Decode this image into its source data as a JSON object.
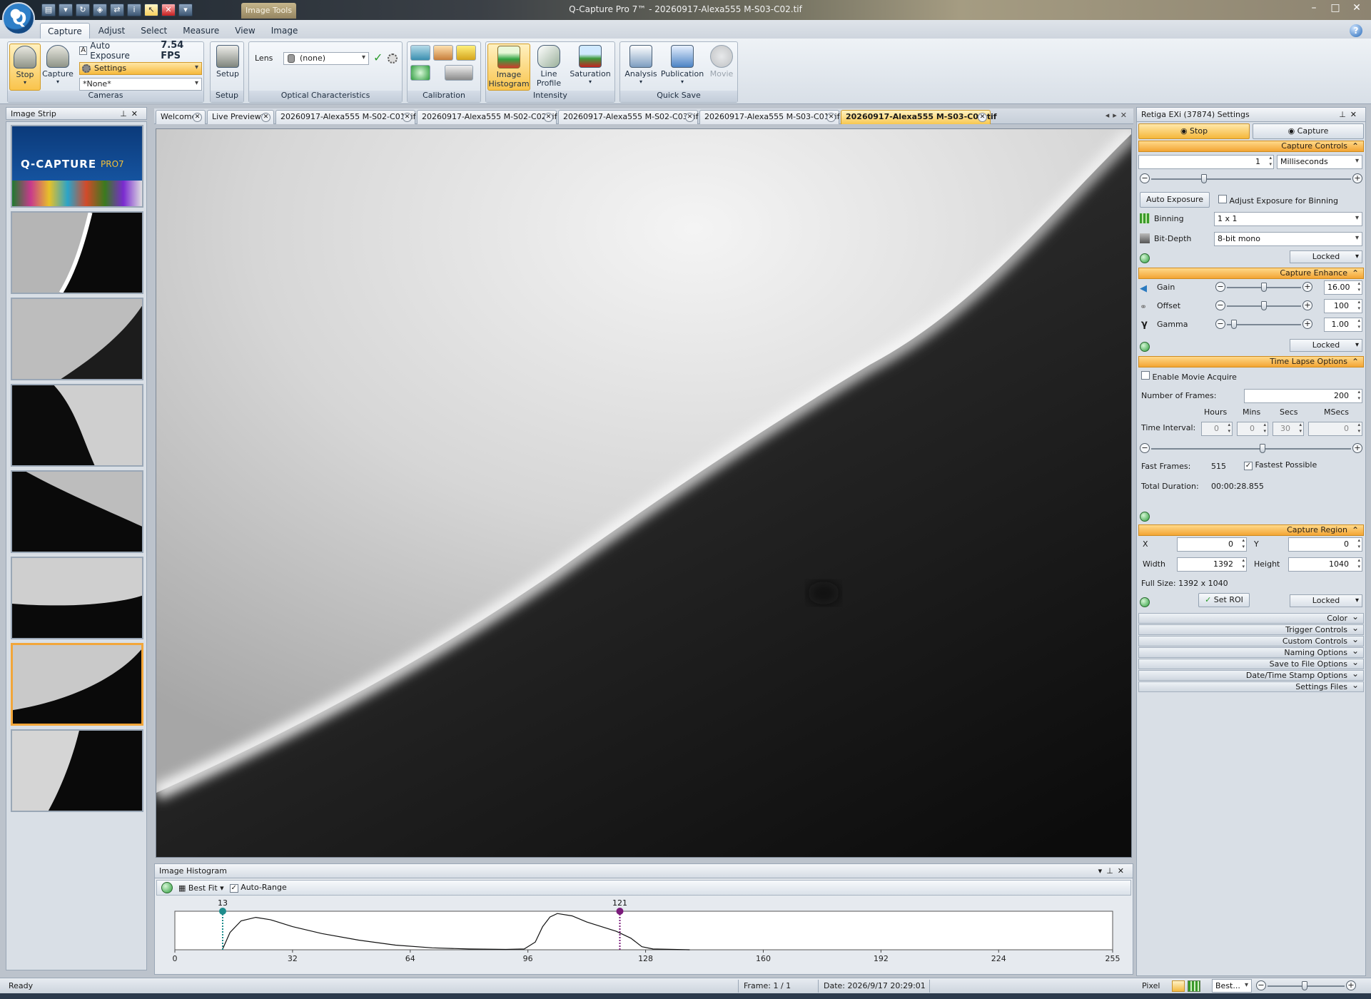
{
  "window": {
    "title": "Q-Capture Pro 7™ - 20260917-Alexa555 M-S03-C02.tif",
    "context_tab": "Image Tools",
    "logo_letter": "Q",
    "help": "?"
  },
  "ribbon_tabs": [
    "Capture",
    "Adjust",
    "Select",
    "Measure",
    "View",
    "Image"
  ],
  "ribbon": {
    "stop_label": "Stop",
    "capture_label": "Capture",
    "auto_exposure_label": "Auto Exposure",
    "fps": "7.54 FPS",
    "settings_label": "Settings",
    "preset_label": "*None*",
    "cameras_group": "Cameras",
    "setup_label": "Setup",
    "setup_group": "Setup",
    "lens_label": "Lens",
    "lens_value": "(none)",
    "optical_group": "Optical Characteristics",
    "calibration_group": "Calibration",
    "image_histogram_label_1": "Image",
    "image_histogram_label_2": "Histogram",
    "line_profile_label_1": "Line",
    "line_profile_label_2": "Profile",
    "saturation_label": "Saturation",
    "intensity_group": "Intensity",
    "analysis_label": "Analysis",
    "publication_label": "Publication",
    "movie_label": "Movie",
    "quicksave_group": "Quick Save"
  },
  "image_strip": {
    "title": "Image Strip",
    "splash_title": "Q-CAPTURE",
    "splash_suffix": "PRO7",
    "selected_index": 6
  },
  "doc_tabs": [
    {
      "label": "Welcome"
    },
    {
      "label": "Live Preview*"
    },
    {
      "label": "20260917-Alexa555 M-S02-C01.tif"
    },
    {
      "label": "20260917-Alexa555 M-S02-C02.tif"
    },
    {
      "label": "20260917-Alexa555 M-S02-C03.tif"
    },
    {
      "label": "20260917-Alexa555 M-S03-C01.tif"
    },
    {
      "label": "20260917-Alexa555 M-S03-C02.tif",
      "active": true
    }
  ],
  "histogram": {
    "title": "Image Histogram",
    "best_fit": "Best Fit",
    "auto_range": "Auto-Range",
    "auto_range_checked": true,
    "low_marker": 13,
    "high_marker": 121,
    "x_min": 0,
    "x_max": 255,
    "ticks": [
      0,
      32,
      64,
      96,
      128,
      160,
      192,
      224,
      255
    ],
    "curve": [
      [
        13,
        0.02
      ],
      [
        15,
        0.45
      ],
      [
        18,
        0.75
      ],
      [
        22,
        0.84
      ],
      [
        26,
        0.78
      ],
      [
        32,
        0.6
      ],
      [
        40,
        0.42
      ],
      [
        50,
        0.25
      ],
      [
        60,
        0.12
      ],
      [
        70,
        0.05
      ],
      [
        80,
        0.02
      ],
      [
        90,
        0.01
      ],
      [
        95,
        0.02
      ],
      [
        98,
        0.2
      ],
      [
        100,
        0.6
      ],
      [
        102,
        0.85
      ],
      [
        104,
        0.94
      ],
      [
        108,
        0.88
      ],
      [
        112,
        0.72
      ],
      [
        116,
        0.6
      ],
      [
        120,
        0.48
      ],
      [
        124,
        0.3
      ],
      [
        127,
        0.08
      ],
      [
        130,
        0.02
      ],
      [
        140,
        0.0
      ]
    ],
    "low_color": "#1e8c8c",
    "high_color": "#7a1a7a"
  },
  "settings": {
    "title": "Retiga EXi (37874) Settings",
    "stop_btn": "Stop",
    "capture_btn": "Capture",
    "capture_controls": "Capture Controls",
    "exposure_value": "1",
    "exposure_unit": "Milliseconds",
    "auto_exposure_btn": "Auto Exposure",
    "adjust_binning": "Adjust Exposure for Binning",
    "binning_label": "Binning",
    "binning_value": "1 x 1",
    "bitdepth_label": "Bit-Depth",
    "bitdepth_value": "8-bit mono",
    "locked": "Locked",
    "capture_enhance": "Capture Enhance",
    "gain_label": "Gain",
    "gain_value": "16.00",
    "offset_label": "Offset",
    "offset_value": "100",
    "gamma_label": "Gamma",
    "gamma_value": "1.00",
    "timelapse": "Time Lapse Options",
    "enable_movie": "Enable Movie Acquire",
    "num_frames_label": "Number of Frames:",
    "num_frames_value": "200",
    "hours_label": "Hours",
    "mins_label": "Mins",
    "secs_label": "Secs",
    "msecs_label": "MSecs",
    "time_interval_label": "Time Interval:",
    "hours_value": "0",
    "mins_value": "0",
    "secs_value": "30",
    "msecs_value": "0",
    "fast_frames_label": "Fast Frames:",
    "fast_frames_value": "515",
    "fastest_possible": "Fastest Possible",
    "fastest_checked": true,
    "total_duration_label": "Total Duration:",
    "total_duration_value": "00:00:28.855",
    "capture_region": "Capture Region",
    "x_label": "X",
    "x_value": "0",
    "y_label": "Y",
    "y_value": "0",
    "width_label": "Width",
    "width_value": "1392",
    "height_label": "Height",
    "height_value": "1040",
    "full_size": "Full Size: 1392 x 1040",
    "set_roi": "Set ROI",
    "collapsed_sections": [
      "Color",
      "Trigger Controls",
      "Custom Controls",
      "Naming Options",
      "Save to File Options",
      "Date/Time Stamp Options",
      "Settings Files"
    ]
  },
  "status": {
    "ready": "Ready",
    "frame": "Frame: 1 / 1",
    "date": "Date: 2026/9/17 20:29:01",
    "pixel": "Pixel",
    "zoom": "Best..."
  }
}
